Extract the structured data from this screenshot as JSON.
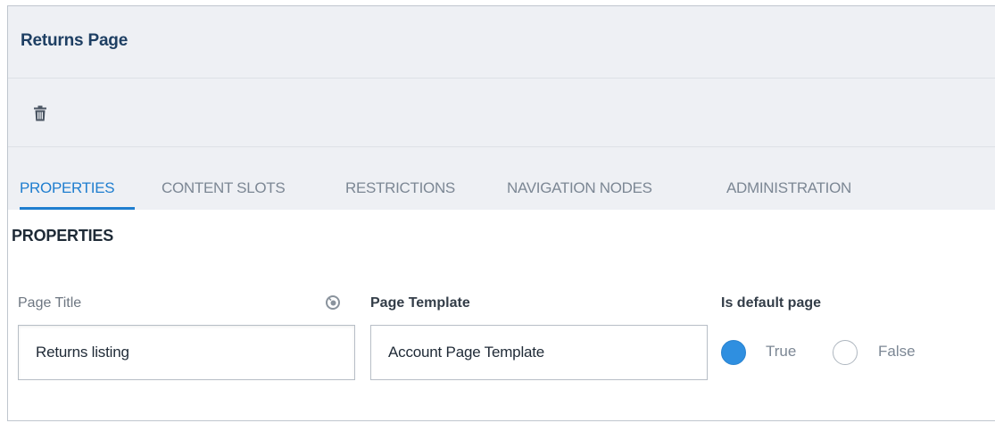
{
  "header": {
    "title": "Returns Page"
  },
  "toolbar": {
    "delete_icon": "trash-icon"
  },
  "tabs": [
    {
      "label": "PROPERTIES",
      "active": true
    },
    {
      "label": "CONTENT SLOTS",
      "active": false
    },
    {
      "label": "RESTRICTIONS",
      "active": false
    },
    {
      "label": "NAVIGATION NODES",
      "active": false
    },
    {
      "label": "ADMINISTRATION",
      "active": false
    }
  ],
  "section": {
    "title": "PROPERTIES"
  },
  "fields": {
    "page_title": {
      "label": "Page Title",
      "value": "Returns listing",
      "localization_icon": "language-icon"
    },
    "page_template": {
      "label": "Page Template",
      "value": "Account Page Template"
    },
    "is_default_page": {
      "label": "Is default page",
      "options": [
        "True",
        "False"
      ],
      "selected": "True"
    }
  },
  "colors": {
    "accent": "#1f7ecf",
    "title": "#1e3f63",
    "header_bg": "#eef0f4"
  }
}
